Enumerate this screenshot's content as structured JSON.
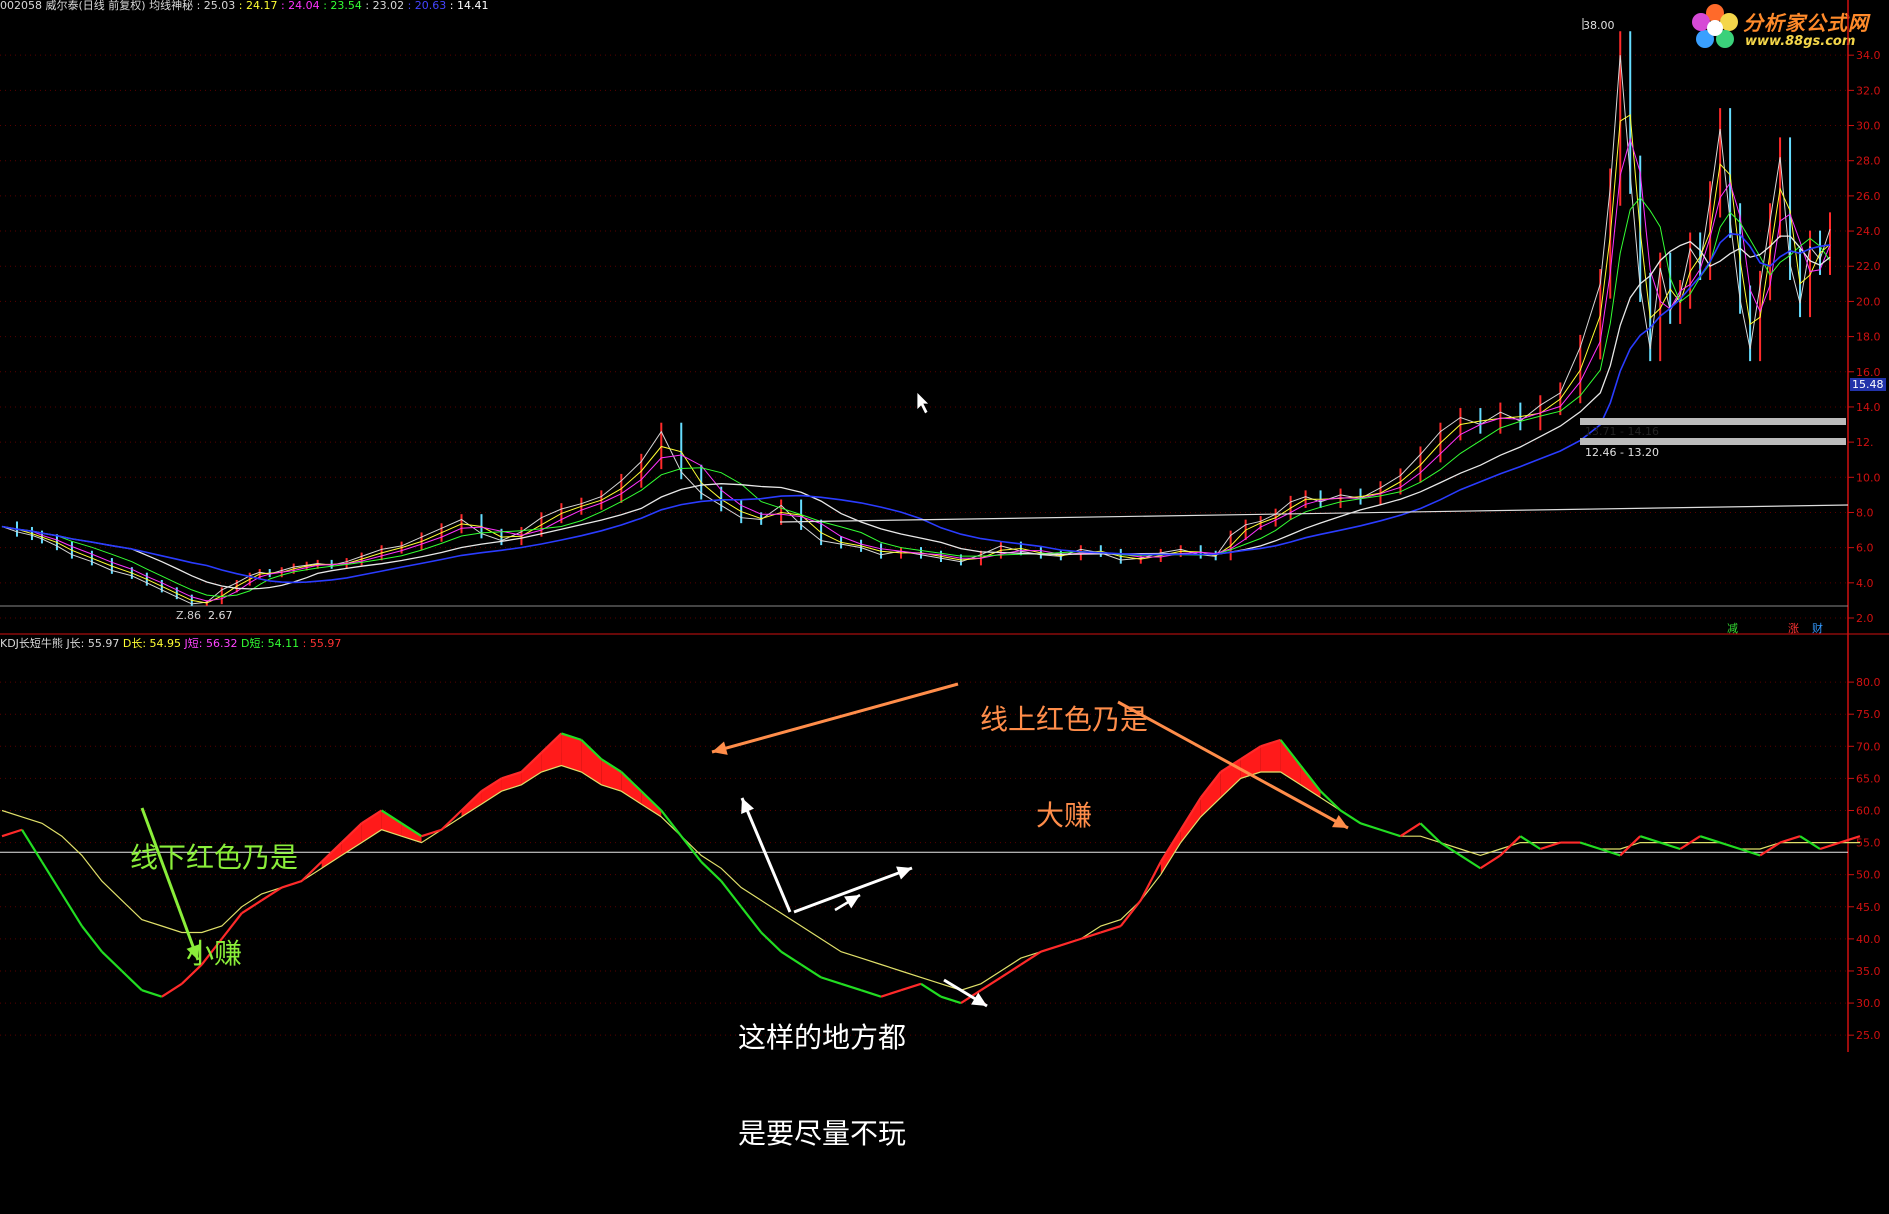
{
  "header_top": {
    "code_name": "002058 威尔泰(日线 前复权) 均线神秘",
    "items": [
      {
        "text": ": 25.03",
        "color": "#d8d8d8"
      },
      {
        "text": ": 24.17",
        "color": "#ffff33"
      },
      {
        "text": ": 24.04",
        "color": "#ff33ff"
      },
      {
        "text": ": 23.54",
        "color": "#33ff33"
      },
      {
        "text": ": 23.02",
        "color": "#d8d8d8"
      },
      {
        "text": ": 20.63",
        "color": "#3333ff"
      },
      {
        "text": ": 14.41",
        "color": "#ffffff"
      }
    ]
  },
  "header_bottom": {
    "name": "KDJ长短牛熊",
    "items": [
      {
        "text": "J长: 55.97",
        "color": "#d8d8d8"
      },
      {
        "text": "D长: 54.95",
        "color": "#ffff33"
      },
      {
        "text": "J短: 56.32",
        "color": "#ff33ff"
      },
      {
        "text": "D短: 54.11",
        "color": "#33ff33"
      },
      {
        "text": ": 55.97",
        "color": "#ff3333"
      }
    ]
  },
  "logo": {
    "title": "分析家公式网",
    "url": "www.88gs.com"
  },
  "price_labels": {
    "peak": "38.00",
    "low": "2.67",
    "low_prefix": "Z.86",
    "current": "15.48",
    "range1": "13.71 - 14.16",
    "range2": "12.46 - 13.20"
  },
  "bottom_tags": {
    "t1": "减",
    "t2": "涨",
    "t3": "财"
  },
  "annotations": {
    "green_line1": "线下红色乃是",
    "green_line2": "小赚",
    "orange_line1": "线上红色乃是",
    "orange_line2": "大赚",
    "white_line1": "这样的地方都",
    "white_line2": "是要尽量不玩"
  },
  "colors": {
    "axis": "#d01010",
    "grid": "#5a0000",
    "up": "#ff2a2a",
    "down": "#22dd22"
  },
  "chart_data": [
    {
      "type": "line",
      "title": "002058 威尔泰(日线 前复权) 均线神秘",
      "ylim": [
        2,
        36
      ],
      "yticks": [
        2,
        4,
        6,
        8,
        10,
        12,
        14,
        16,
        18,
        20,
        22,
        24,
        26,
        28,
        30,
        32,
        34
      ],
      "ytick_labels": [
        "2.0",
        "4.0",
        "6.0",
        "8.0",
        "10.0",
        "12.",
        "14.0",
        "16.0",
        "18.0",
        "20.0",
        "22.0",
        "24.0",
        "26.0",
        "28.0",
        "30.0",
        "32.0",
        "34.0"
      ],
      "x": [
        0,
        15,
        30,
        40,
        55,
        70,
        90,
        110,
        130,
        145,
        160,
        175,
        190,
        205,
        220,
        235,
        248,
        258,
        268,
        280,
        292,
        305,
        316,
        330,
        345,
        360,
        380,
        400,
        420,
        440,
        460,
        480,
        500,
        520,
        540,
        560,
        580,
        600,
        620,
        640,
        660,
        680,
        700,
        720,
        740,
        760,
        780,
        800,
        820,
        840,
        860,
        880,
        900,
        920,
        940,
        960,
        980,
        1000,
        1020,
        1040,
        1060,
        1080,
        1100,
        1120,
        1140,
        1160,
        1180,
        1200,
        1215,
        1230,
        1245,
        1260,
        1275,
        1290,
        1305,
        1320,
        1340,
        1360,
        1380,
        1400,
        1420,
        1440,
        1460,
        1480,
        1500,
        1520,
        1540,
        1560,
        1580,
        1600,
        1610,
        1620,
        1630,
        1640,
        1650,
        1660,
        1670,
        1680,
        1690,
        1700,
        1710,
        1720,
        1730,
        1740,
        1750,
        1760,
        1770,
        1780,
        1790,
        1800,
        1810,
        1820,
        1830
      ],
      "series": [
        {
          "color": "#d8d8d8",
          "values": [
            7.2,
            6.9,
            6.7,
            6.5,
            6.1,
            5.6,
            5.2,
            4.7,
            4.4,
            4.0,
            3.6,
            3.2,
            2.8,
            2.9,
            3.6,
            4.0,
            4.4,
            4.6,
            4.5,
            4.7,
            4.9,
            5.0,
            5.1,
            5.0,
            5.2,
            5.5,
            5.9,
            6.1,
            6.6,
            7.1,
            7.6,
            6.8,
            6.4,
            6.9,
            7.7,
            8.2,
            8.5,
            8.9,
            9.8,
            10.9,
            12.6,
            10.3,
            9.1,
            8.4,
            7.7,
            7.6,
            8.4,
            7.3,
            6.4,
            6.2,
            6.0,
            5.6,
            5.8,
            5.6,
            5.4,
            5.2,
            5.6,
            6.1,
            5.8,
            5.6,
            5.5,
            5.9,
            5.7,
            5.3,
            5.4,
            5.7,
            5.9,
            5.6,
            5.5,
            6.7,
            7.3,
            7.5,
            7.9,
            8.6,
            8.9,
            8.6,
            9.0,
            8.8,
            9.4,
            10.1,
            11.3,
            12.6,
            13.4,
            13.0,
            13.7,
            13.2,
            14.1,
            14.8,
            17.4,
            21.0,
            26.5,
            34.0,
            27.2,
            20.8,
            17.3,
            21.9,
            19.5,
            20.4,
            23.0,
            22.1,
            25.8,
            29.8,
            24.6,
            20.1,
            17.3,
            20.9,
            24.6,
            28.2,
            22.1,
            19.9,
            23.1,
            22.4,
            24.1
          ]
        }
      ]
    },
    {
      "type": "line",
      "title": "KDJ长短牛熊",
      "ylim": [
        23,
        85
      ],
      "yticks": [
        25,
        30,
        35,
        40,
        45,
        50,
        55,
        60,
        65,
        70,
        75,
        80
      ],
      "ytick_labels": [
        "25.0",
        "30.0",
        "35.0",
        "40.0",
        "45.0",
        "50.0",
        "55.0",
        "60.0",
        "65.0",
        "70.0",
        "75.0",
        "80.0"
      ],
      "x": [
        0,
        20,
        40,
        60,
        80,
        100,
        120,
        140,
        160,
        180,
        200,
        220,
        240,
        260,
        280,
        300,
        320,
        340,
        360,
        380,
        400,
        420,
        440,
        460,
        480,
        500,
        520,
        540,
        560,
        580,
        600,
        620,
        640,
        660,
        680,
        700,
        720,
        740,
        760,
        780,
        800,
        820,
        840,
        860,
        880,
        900,
        920,
        940,
        960,
        980,
        1000,
        1020,
        1040,
        1060,
        1080,
        1100,
        1120,
        1140,
        1160,
        1180,
        1200,
        1220,
        1240,
        1260,
        1280,
        1300,
        1320,
        1340,
        1360,
        1380,
        1400,
        1420,
        1440,
        1460,
        1480,
        1500,
        1520,
        1540,
        1560,
        1580,
        1600,
        1620,
        1640,
        1660,
        1680,
        1700,
        1720,
        1740,
        1760,
        1780,
        1800,
        1820,
        1840,
        1860
      ],
      "series": [
        {
          "name": "J长",
          "color": "#22dd22",
          "values": [
            56,
            57,
            52,
            47,
            42,
            38,
            35,
            32,
            31,
            33,
            36,
            40,
            44,
            46,
            48,
            49,
            52,
            55,
            58,
            60,
            58,
            56,
            57,
            60,
            63,
            65,
            66,
            69,
            72,
            71,
            68,
            66,
            63,
            60,
            56,
            52,
            49,
            45,
            41,
            38,
            36,
            34,
            33,
            32,
            31,
            32,
            33,
            31,
            30,
            32,
            34,
            36,
            38,
            39,
            40,
            41,
            42,
            46,
            52,
            57,
            62,
            66,
            68,
            70,
            71,
            67,
            63,
            60,
            58,
            57,
            56,
            58,
            55,
            53,
            51,
            53,
            56,
            54,
            55,
            55,
            54,
            53,
            56,
            55,
            54,
            56,
            55,
            54,
            53,
            55,
            56,
            54,
            55,
            56
          ]
        },
        {
          "name": "D长",
          "color": "#e0e06a",
          "values": [
            60,
            59,
            58,
            56,
            53,
            49,
            46,
            43,
            42,
            41,
            41,
            42,
            45,
            47,
            48,
            49,
            51,
            53,
            55,
            57,
            56,
            55,
            57,
            59,
            61,
            63,
            64,
            66,
            67,
            66,
            64,
            63,
            61,
            59,
            56,
            53,
            51,
            48,
            46,
            44,
            42,
            40,
            38,
            37,
            36,
            35,
            34,
            33,
            32,
            33,
            35,
            37,
            38,
            39,
            40,
            42,
            43,
            46,
            50,
            55,
            59,
            62,
            65,
            66,
            66,
            64,
            62,
            60,
            58,
            57,
            56,
            56,
            55,
            54,
            53,
            54,
            55,
            55,
            55,
            55,
            54,
            54,
            55,
            55,
            55,
            55,
            55,
            54,
            54,
            55,
            55,
            55,
            55,
            55
          ]
        }
      ]
    }
  ]
}
